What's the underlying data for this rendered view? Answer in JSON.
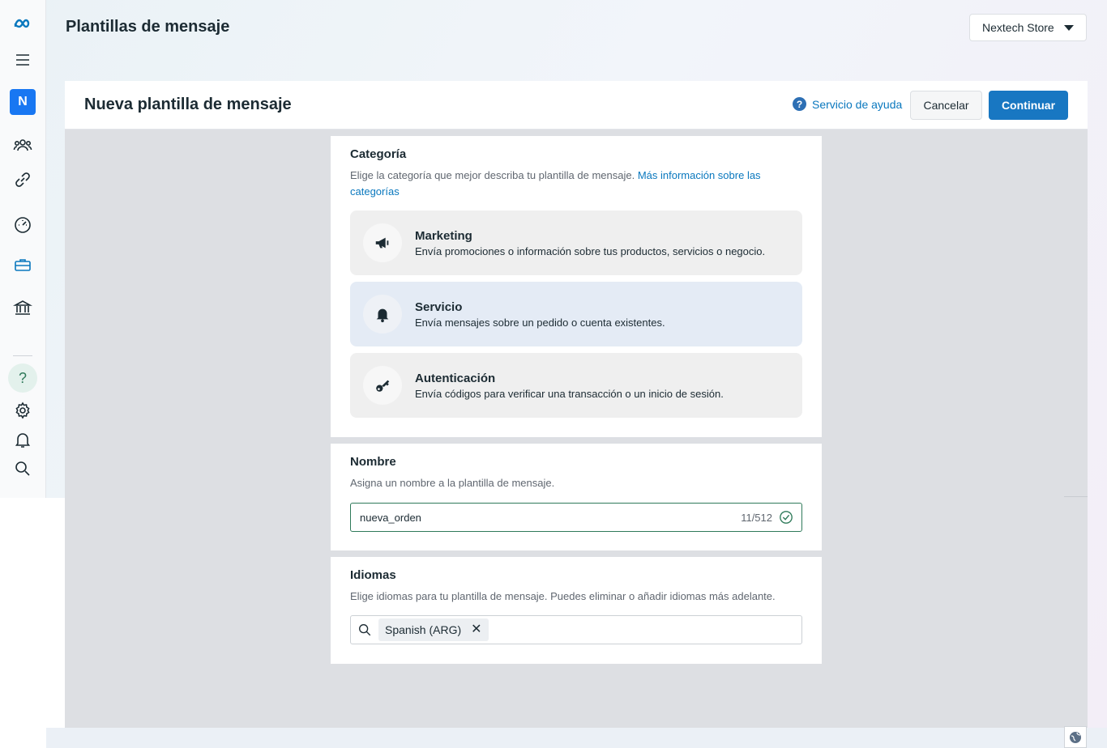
{
  "header": {
    "title": "Plantillas de mensaje",
    "store_name": "Nextech Store"
  },
  "nav": {
    "avatar_letter": "N",
    "help_symbol": "?"
  },
  "form": {
    "heading": "Nueva plantilla de mensaje",
    "help_link": "Servicio de ayuda",
    "cancel_label": "Cancelar",
    "continue_label": "Continuar"
  },
  "category": {
    "title": "Categoría",
    "description": "Elige la categoría que mejor describa tu plantilla de mensaje.",
    "more_info_link": "Más información sobre las categorías",
    "options": [
      {
        "title": "Marketing",
        "description": "Envía promociones o información sobre tus productos, servicios o negocio.",
        "icon": "megaphone-icon",
        "selected": false
      },
      {
        "title": "Servicio",
        "description": "Envía mensajes sobre un pedido o cuenta existentes.",
        "icon": "bell-icon",
        "selected": true
      },
      {
        "title": "Autenticación",
        "description": "Envía códigos para verificar una transacción o un inicio de sesión.",
        "icon": "key-icon",
        "selected": false
      }
    ]
  },
  "name": {
    "title": "Nombre",
    "description": "Asigna un nombre a la plantilla de mensaje.",
    "value": "nueva_orden",
    "counter": "11/512"
  },
  "languages": {
    "title": "Idiomas",
    "description": "Elige idiomas para tu plantilla de mensaje. Puedes eliminar o añadir idiomas más adelante.",
    "selected": [
      "Spanish (ARG)"
    ],
    "remove_symbol": "✕"
  },
  "colors": {
    "accent": "#1877c2",
    "link": "#0a78be",
    "valid_border": "#2f7a5a",
    "selected_card": "#e4ebf5"
  }
}
